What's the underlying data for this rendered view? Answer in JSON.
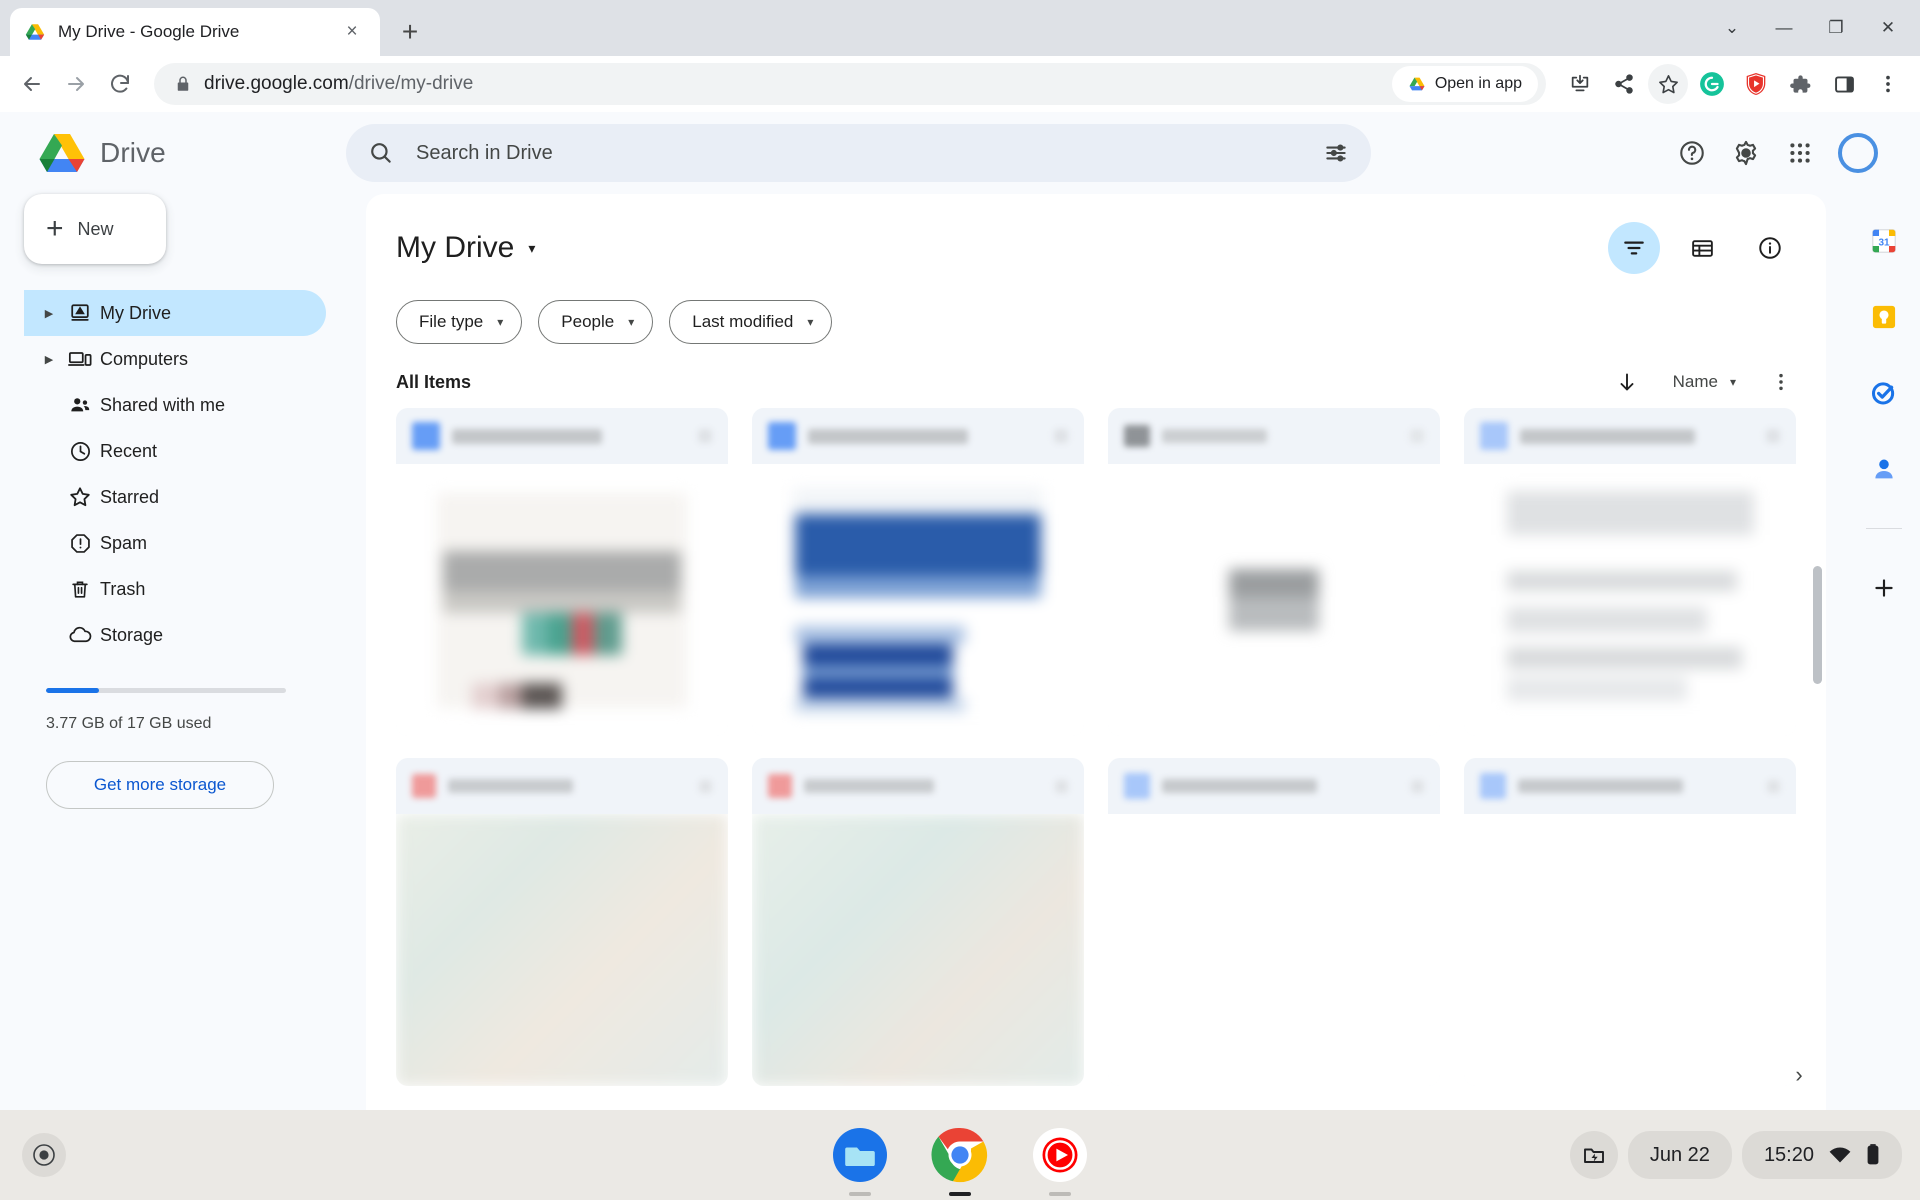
{
  "browser": {
    "tab": {
      "title": "My Drive - Google Drive",
      "favicon": "google-drive-favicon",
      "close": "×"
    },
    "new_tab_label": "+",
    "window_controls": {
      "chevron": "⌄",
      "minimize": "—",
      "maximize": "❐",
      "close": "✕"
    },
    "nav": {
      "back": "←",
      "forward": "→",
      "reload": "⟳"
    },
    "omnibox": {
      "lock_icon": "lock-icon",
      "domain": "drive.google.com",
      "path": "/drive/my-drive",
      "open_in_app_label": "Open in app"
    },
    "toolbar_icons": [
      "install-app-icon",
      "share-icon",
      "bookmark-star-icon",
      "grammarly-extension-icon",
      "adguard-extension-icon",
      "extensions-puzzle-icon",
      "side-panel-icon",
      "chrome-menu-icon"
    ]
  },
  "drive": {
    "logo_text": "Drive",
    "search": {
      "placeholder": "Search in Drive",
      "value": "",
      "icon": "search-icon",
      "tune_icon": "tune-icon"
    },
    "header_icons": [
      {
        "name": "help-icon",
        "glyph": "?"
      },
      {
        "name": "settings-gear-icon",
        "glyph": "gear"
      },
      {
        "name": "google-apps-grid-icon",
        "glyph": "grid"
      },
      {
        "name": "account-avatar",
        "glyph": "ring"
      }
    ],
    "new_button": {
      "label": "New",
      "icon": "plus-icon"
    },
    "nav_items": [
      {
        "label": "My Drive",
        "icon": "my-drive-icon",
        "expandable": true,
        "active": true
      },
      {
        "label": "Computers",
        "icon": "computers-icon",
        "expandable": true,
        "active": false
      },
      {
        "label": "Shared with me",
        "icon": "shared-with-me-icon",
        "expandable": false,
        "active": false
      },
      {
        "label": "Recent",
        "icon": "recent-clock-icon",
        "expandable": false,
        "active": false
      },
      {
        "label": "Starred",
        "icon": "starred-icon",
        "expandable": false,
        "active": false
      },
      {
        "label": "Spam",
        "icon": "spam-icon",
        "expandable": false,
        "active": false
      },
      {
        "label": "Trash",
        "icon": "trash-icon",
        "expandable": false,
        "active": false
      },
      {
        "label": "Storage",
        "icon": "storage-cloud-icon",
        "expandable": false,
        "active": false
      }
    ],
    "storage": {
      "used_text": "3.77 GB of 17 GB used",
      "percent": 22,
      "bar_color": "#1a73e8",
      "get_more_label": "Get more storage"
    },
    "main": {
      "page_title": "My Drive",
      "title_caret": "▾",
      "view_controls": [
        {
          "name": "filter-active-button",
          "icon": "filter-icon",
          "active": true
        },
        {
          "name": "list-view-button",
          "icon": "list-view-icon",
          "active": false
        },
        {
          "name": "details-info-button",
          "icon": "info-icon",
          "active": false
        }
      ],
      "filter_chips": [
        {
          "label": "File type",
          "caret": "▾"
        },
        {
          "label": "People",
          "caret": "▾"
        },
        {
          "label": "Last modified",
          "caret": "▾"
        }
      ],
      "section_label": "All Items",
      "sort": {
        "direction_icon": "arrow-down-icon",
        "field": "Name",
        "caret": "▾",
        "more_icon": "more-vert-icon"
      },
      "next_page_icon": "chevron-right-icon",
      "files": [
        {
          "name": "file-card-1",
          "type_color": "#669df6",
          "thumb": "document-preview"
        },
        {
          "name": "file-card-2",
          "type_color": "#669df6",
          "thumb": "slides-preview"
        },
        {
          "name": "file-card-3",
          "type_color": "#9aa0a6",
          "thumb": "blank-preview"
        },
        {
          "name": "file-card-4",
          "type_color": "#a8c7fa",
          "thumb": "text-preview"
        },
        {
          "name": "file-card-5",
          "type_color": "#ef9a9a",
          "thumb": "image-preview"
        },
        {
          "name": "file-card-6",
          "type_color": "#ef9a9a",
          "thumb": "image-preview"
        },
        {
          "name": "file-card-7",
          "type_color": "#a8c7fa",
          "thumb": "blank-preview"
        },
        {
          "name": "file-card-8",
          "type_color": "#a8c7fa",
          "thumb": "blank-preview"
        }
      ]
    },
    "right_rail": [
      {
        "name": "google-calendar-icon",
        "label": "31"
      },
      {
        "name": "google-keep-icon",
        "label": ""
      },
      {
        "name": "google-tasks-icon",
        "label": ""
      },
      {
        "name": "google-contacts-icon",
        "label": ""
      },
      {
        "name": "add-apps-icon",
        "label": "+"
      }
    ]
  },
  "shelf": {
    "launcher_icon": "launcher-icon",
    "apps": [
      {
        "name": "files-app-icon",
        "active": false
      },
      {
        "name": "chrome-app-icon",
        "active": true
      },
      {
        "name": "youtube-music-app-icon",
        "active": false
      }
    ],
    "status": {
      "capture_icon": "screen-capture-icon",
      "date": "Jun 22",
      "time": "15:20",
      "wifi_icon": "wifi-icon",
      "battery_icon": "battery-icon"
    }
  }
}
